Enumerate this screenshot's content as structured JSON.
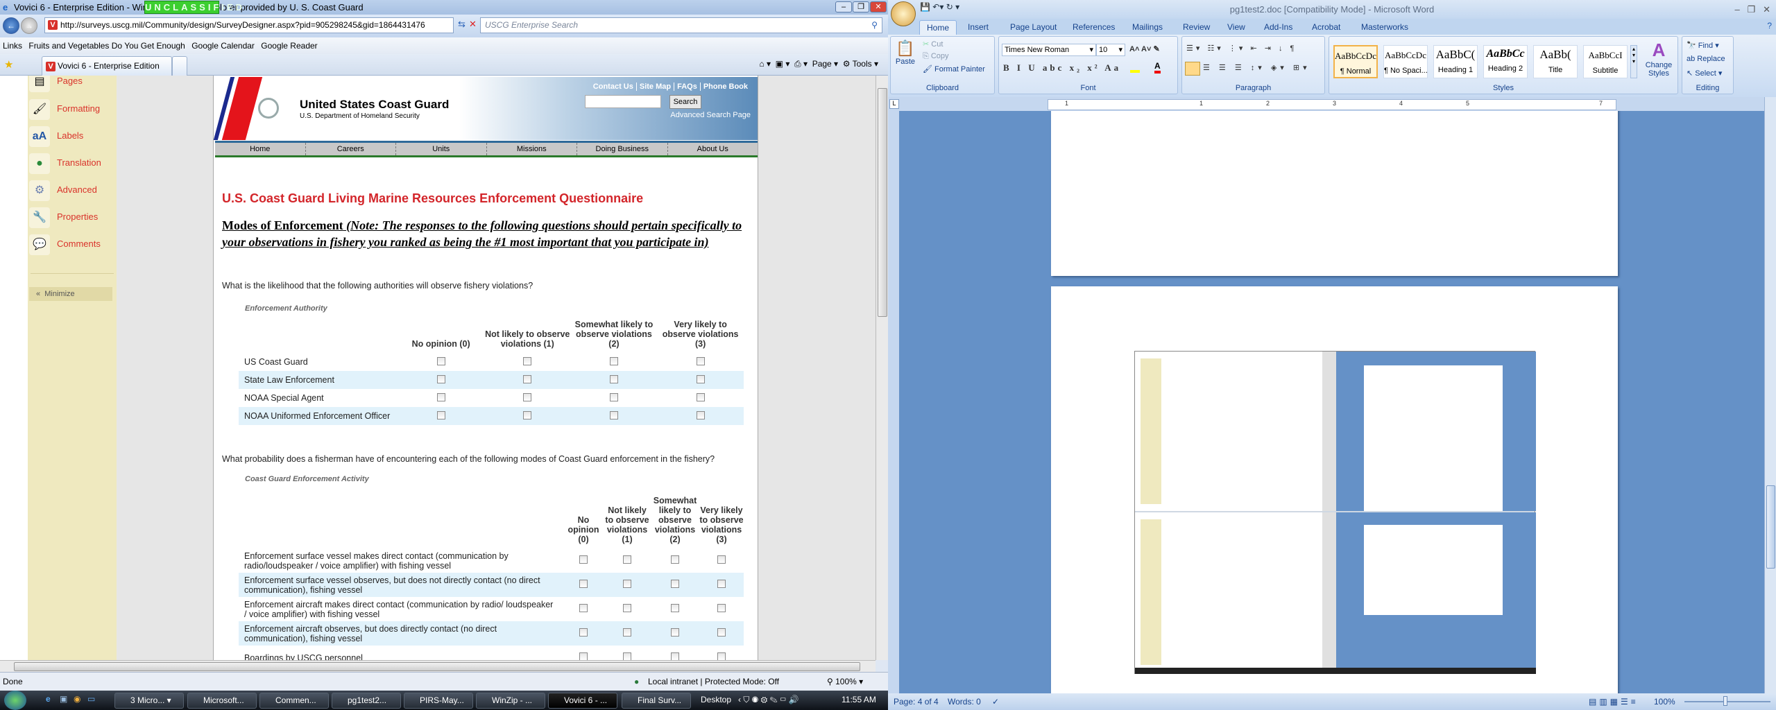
{
  "ie": {
    "title": "Vovici 6 - Enterprise Edition - Windows Internet Explorer provided by U. S. Coast Guard",
    "classification_banner": "UNCLASSIFIED",
    "url": "http://surveys.uscg.mil/Community/design/SurveyDesigner.aspx?pid=905298245&gid=1864431476",
    "search_placeholder": "USCG Enterprise Search",
    "links_label": "Links",
    "links": [
      "Fruits and Vegetables Do You Get Enough",
      "Google Calendar",
      "Google Reader"
    ],
    "tab_title": "Vovici 6 - Enterprise Edition",
    "toolbar": {
      "page": "Page",
      "tools": "Tools"
    },
    "status": {
      "text": "Done",
      "zone": "Local intranet | Protected Mode: Off",
      "zoom": "100%"
    }
  },
  "sidebar": {
    "items": [
      {
        "label": "Pages",
        "icon": "pages-icon"
      },
      {
        "label": "Formatting",
        "icon": "brush-icon"
      },
      {
        "label": "Labels",
        "icon": "labels-icon"
      },
      {
        "label": "Translation",
        "icon": "globe-icon"
      },
      {
        "label": "Advanced",
        "icon": "gears-icon"
      },
      {
        "label": "Properties",
        "icon": "wrench-icon"
      },
      {
        "label": "Comments",
        "icon": "comments-icon"
      }
    ],
    "minimize": "Minimize"
  },
  "site": {
    "name": "United States Coast Guard",
    "dept": "U.S. Department of Homeland Security",
    "top_links": [
      "Contact Us",
      "Site Map",
      "FAQs",
      "Phone Book"
    ],
    "search_button": "Search",
    "advanced_search": "Advanced Search Page",
    "nav": [
      "Home",
      "Careers",
      "Units",
      "Missions",
      "Doing Business",
      "About Us"
    ]
  },
  "survey": {
    "title": "U.S. Coast Guard Living Marine Resources Enforcement Questionnaire",
    "section_heading": "Modes of Enforcement",
    "section_note": "(Note: The responses to the following questions should pertain specifically to your observations in fishery you ranked as being the #1 most important that you participate in)",
    "q1": {
      "text": "What is the likelihood that the following authorities will observe fishery violations?",
      "group_label": "Enforcement Authority",
      "columns": [
        "No opinion (0)",
        "Not likely to observe violations (1)",
        "Somewhat likely to observe violations (2)",
        "Very likely to observe violations (3)"
      ],
      "rows": [
        "US Coast Guard",
        "State Law Enforcement",
        "NOAA Special Agent",
        "NOAA Uniformed Enforcement Officer"
      ]
    },
    "q2": {
      "text": "What probability does a fisherman have of encountering each of the following modes of Coast Guard enforcement in the fishery?",
      "group_label": "Coast Guard Enforcement Activity",
      "columns": [
        "No opinion (0)",
        "Not likely to observe violations (1)",
        "Somewhat likely to observe violations (2)",
        "Very likely to observe violations (3)"
      ],
      "rows": [
        "Enforcement surface vessel makes direct contact (communication by radio/loudspeaker / voice amplifier) with fishing vessel",
        "Enforcement surface vessel observes, but does not directly contact (no direct communication), fishing vessel",
        "Enforcement aircraft makes direct contact (communication by radio/ loudspeaker / voice amplifier) with fishing vessel",
        "Enforcement aircraft observes, but does directly contact (no direct communication), fishing vessel",
        "Boardings by USCG personnel"
      ]
    }
  },
  "taskbar": {
    "items": [
      "3 Micro...",
      "Microsoft...",
      "Commen...",
      "pg1test2...",
      "PIRS-May...",
      "WinZip - ...",
      "Vovici 6 - ...",
      "Final Surv..."
    ],
    "active_index": 6,
    "desktop": "Desktop",
    "clock": "11:55 AM"
  },
  "word": {
    "title": "pg1test2.doc [Compatibility Mode] - Microsoft Word",
    "tabs": [
      "Home",
      "Insert",
      "Page Layout",
      "References",
      "Mailings",
      "Review",
      "View",
      "Add-Ins",
      "Acrobat",
      "Masterworks"
    ],
    "clipboard": {
      "paste": "Paste",
      "cut": "Cut",
      "copy": "Copy",
      "format_painter": "Format Painter",
      "label": "Clipboard"
    },
    "font": {
      "name": "Times New Roman",
      "size": "10",
      "label": "Font"
    },
    "paragraph_label": "Paragraph",
    "styles": [
      {
        "preview": "AaBbCcDc",
        "name": "¶ Normal"
      },
      {
        "preview": "AaBbCcDc",
        "name": "¶ No Spaci..."
      },
      {
        "preview": "AaBbC(",
        "name": "Heading 1"
      },
      {
        "preview": "AaBbCc",
        "name": "Heading 2"
      },
      {
        "preview": "AaBb(",
        "name": "Title"
      },
      {
        "preview": "AaBbCcI",
        "name": "Subtitle"
      }
    ],
    "change_styles": "Change Styles",
    "styles_label": "Styles",
    "editing": {
      "find": "Find",
      "replace": "Replace",
      "select": "Select",
      "label": "Editing"
    },
    "ruler_marks": [
      "1",
      "1",
      "2",
      "3",
      "4",
      "5",
      "7"
    ],
    "status": {
      "page": "Page: 4 of 4",
      "words": "Words: 0",
      "zoom": "100%"
    }
  }
}
